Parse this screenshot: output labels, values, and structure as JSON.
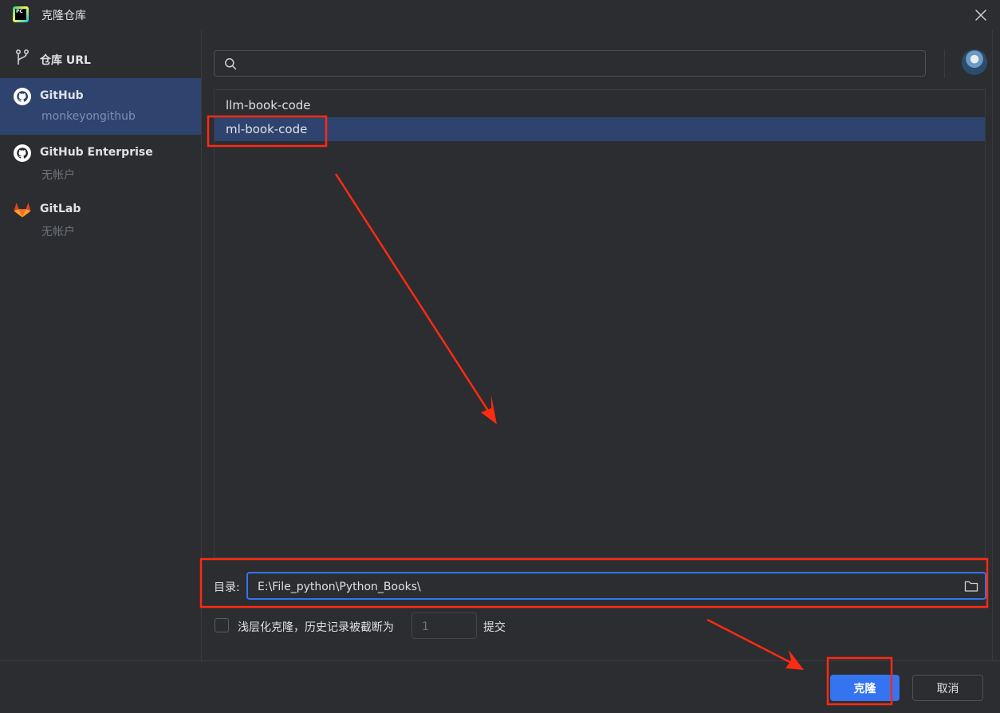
{
  "window": {
    "title": "克隆仓库"
  },
  "sidebar": {
    "items": [
      {
        "label": "仓库 URL",
        "sub": ""
      },
      {
        "label": "GitHub",
        "sub": "monkeyongithub"
      },
      {
        "label": "GitHub Enterprise",
        "sub": "无帐户"
      },
      {
        "label": "GitLab",
        "sub": "无帐户"
      }
    ],
    "selected_index": 1
  },
  "search": {
    "value": "",
    "placeholder": ""
  },
  "repositories": [
    {
      "name": "llm-book-code"
    },
    {
      "name": "ml-book-code"
    }
  ],
  "selected_repository_index": 1,
  "directory": {
    "label": "目录:",
    "value": "E:\\File_python\\Python_Books\\"
  },
  "shallow_clone": {
    "label": "浅层化克隆，历史记录被截断为",
    "depth_placeholder": "1",
    "suffix": "提交",
    "checked": false
  },
  "buttons": {
    "clone": "克隆",
    "cancel": "取消"
  },
  "colors": {
    "background": "#2b2d30",
    "selection": "#2e436e",
    "accent": "#3574f0",
    "annotation": "#ff2a12"
  },
  "icons": {
    "app": "pycharm-logo-icon",
    "close": "close-icon",
    "url": "git-branch-icon",
    "github": "github-icon",
    "gitlab": "gitlab-icon",
    "search": "search-icon",
    "folder": "folder-icon"
  }
}
